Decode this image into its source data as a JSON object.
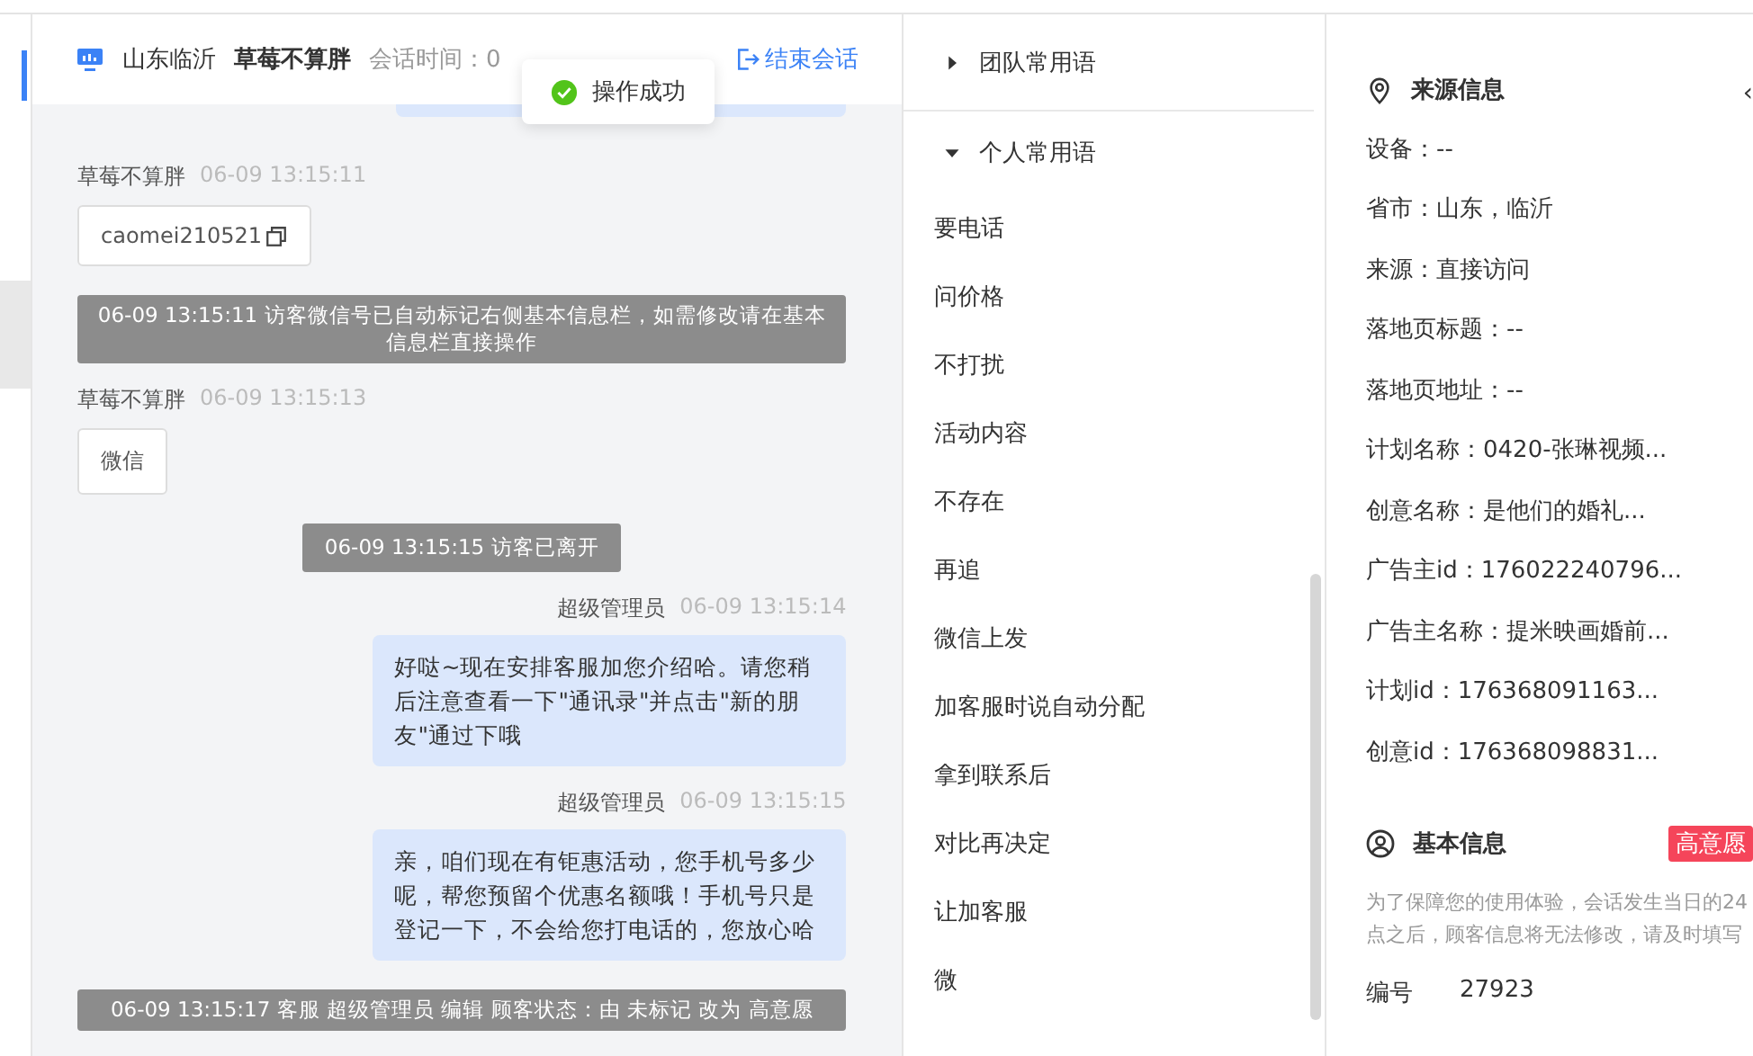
{
  "chat_header": {
    "location": "山东临沂",
    "visitor_name": "草莓不算胖",
    "session_time": "会话时间：0",
    "end_button": "结束会话"
  },
  "toast": {
    "text": "操作成功"
  },
  "messages": [
    {
      "kind": "visitor",
      "sender": "草莓不算胖",
      "time": "06-09 13:15:11",
      "text": "caomei210521",
      "copyable": true
    },
    {
      "kind": "system",
      "text": "06-09 13:15:11 访客微信号已自动标记右侧基本信息栏，如需修改请在基本信息栏直接操作"
    },
    {
      "kind": "visitor",
      "sender": "草莓不算胖",
      "time": "06-09 13:15:13",
      "text": "微信",
      "copyable": false
    },
    {
      "kind": "system",
      "text": "06-09 13:15:15 访客已离开"
    },
    {
      "kind": "agent",
      "sender": "超级管理员",
      "time": "06-09 13:15:14",
      "text": "好哒~现在安排客服加您介绍哈。请您稍后注意查看一下\"通讯录\"并点击\"新的朋友\"通过下哦"
    },
    {
      "kind": "agent",
      "sender": "超级管理员",
      "time": "06-09 13:15:15",
      "text": "亲，咱们现在有钜惠活动，您手机号多少呢，帮您预留个优惠名额哦！手机号只是登记一下，不会给您打电话的，您放心哈"
    },
    {
      "kind": "system",
      "text": "06-09 13:15:17 客服 超级管理员 编辑 顾客状态：由 未标记 改为 高意愿"
    }
  ],
  "phrase_groups": [
    {
      "title": "团队常用语",
      "expanded": false
    },
    {
      "title": "个人常用语",
      "expanded": true,
      "items": [
        "要电话",
        "问价格",
        "不打扰",
        "活动内容",
        "不存在",
        "再追",
        "微信上发",
        "加客服时说自动分配",
        "拿到联系后",
        "对比再决定",
        "让加客服",
        "微"
      ]
    }
  ],
  "source_info": {
    "collapse_caret": "‹",
    "title": "来源信息",
    "fields": [
      "设备：--",
      "省市：山东，临沂",
      "来源：直接访问",
      "落地页标题：--",
      "落地页地址：--",
      "计划名称：0420-张琳视频...",
      "创意名称：是他们的婚礼...",
      "广告主id：176022240796...",
      "广告主名称：提米映画婚前...",
      "计划id：176368091163...",
      "创意id：176368098831..."
    ]
  },
  "basic_info": {
    "title": "基本信息",
    "badge": "高意愿",
    "note": "为了保障您的使用体验，会话发生当日的24点之后，顾客信息将无法修改，请及时填写",
    "fields": [
      {
        "label": "编号",
        "value": "27923"
      }
    ]
  }
}
